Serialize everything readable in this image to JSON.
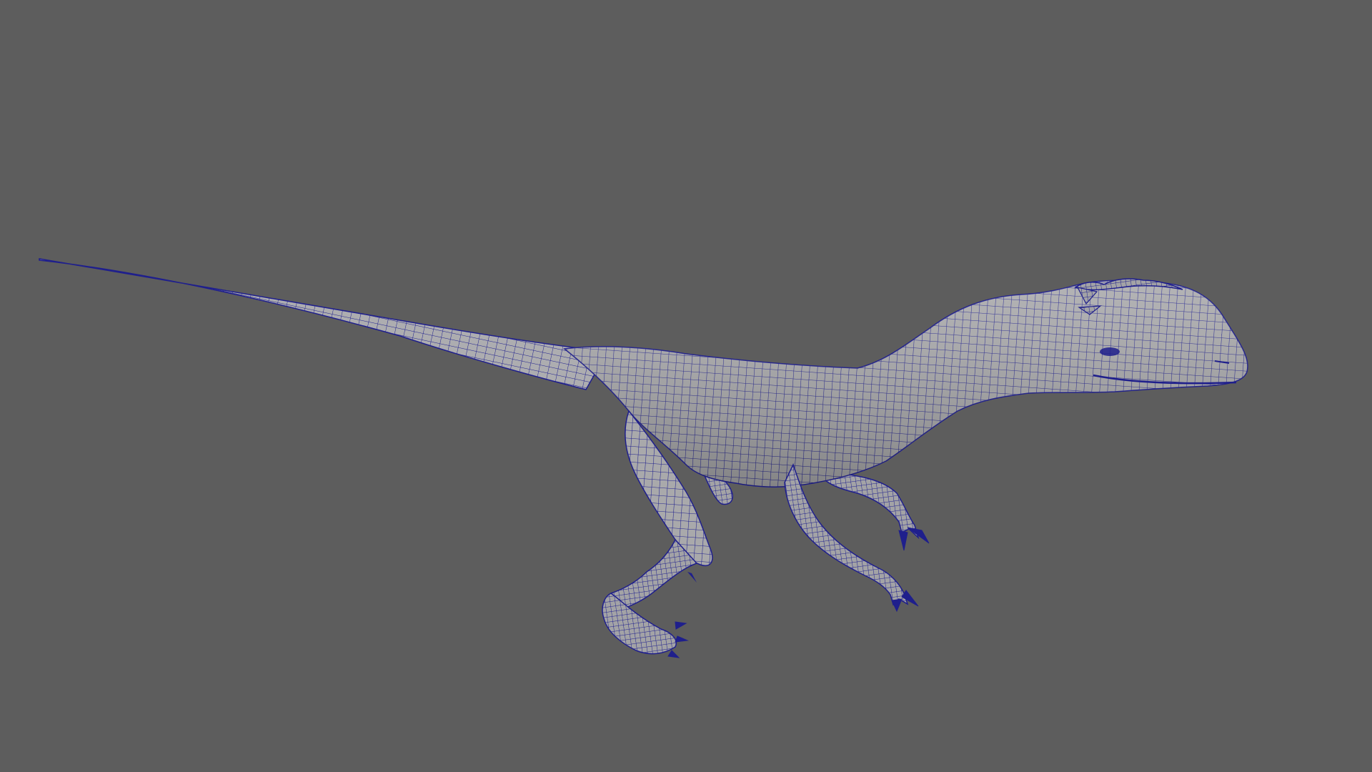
{
  "viewport": {
    "background_color": "#5d5d5d",
    "model": {
      "subject": "raptor-dinosaur-mesh",
      "display_mode": "wireframe-on-shaded",
      "surface_color": "#a9a9ab",
      "wire_color": "#1f1f8c",
      "shadow_color": "#6f6f72"
    }
  }
}
